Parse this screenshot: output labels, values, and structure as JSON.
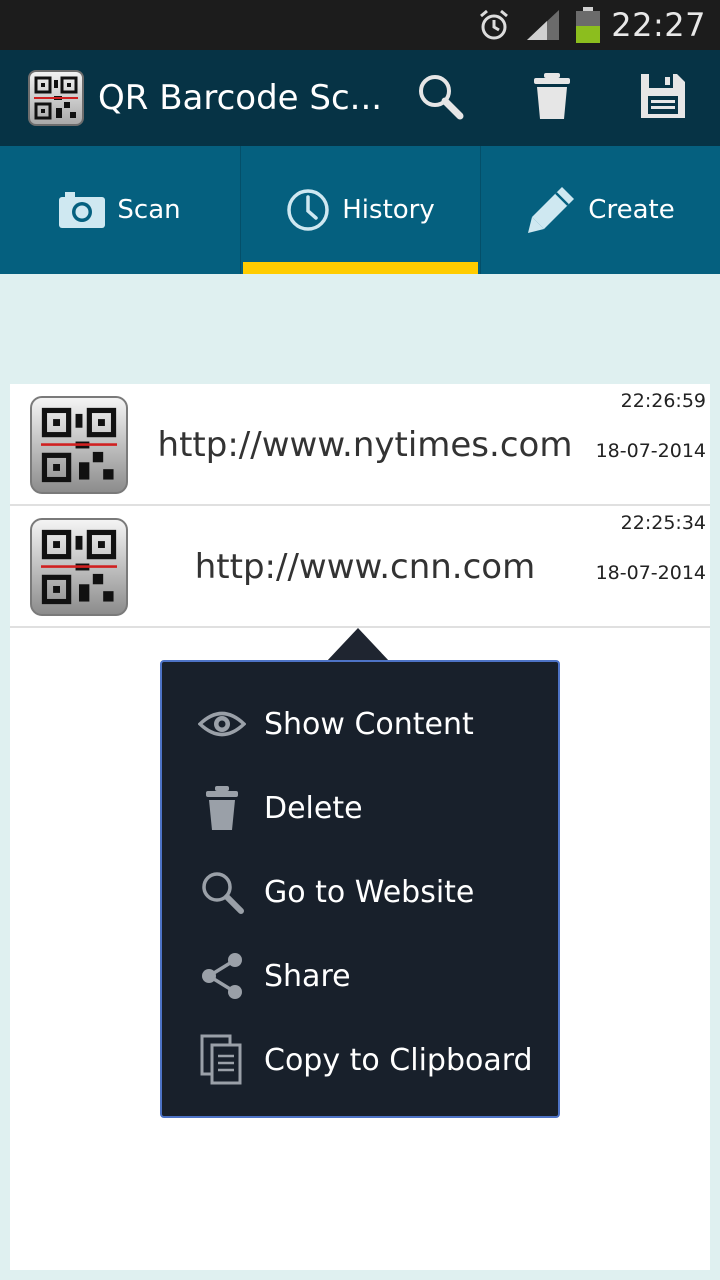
{
  "status_bar": {
    "time": "22:27",
    "icons": [
      "alarm-icon",
      "signal-icon",
      "battery-icon"
    ]
  },
  "action_bar": {
    "title": "QR Barcode Sc...",
    "actions": [
      "search-icon",
      "trash-icon",
      "save-icon"
    ]
  },
  "tabs": [
    {
      "label": "Scan",
      "icon": "camera-icon",
      "active": false
    },
    {
      "label": "History",
      "icon": "clock-icon",
      "active": true
    },
    {
      "label": "Create",
      "icon": "pencil-icon",
      "active": false
    }
  ],
  "history": [
    {
      "url": "http://www.nytimes.com",
      "time": "22:26:59",
      "date": "18-07-2014"
    },
    {
      "url": "http://www.cnn.com",
      "time": "22:25:34",
      "date": "18-07-2014"
    }
  ],
  "context_menu": {
    "items": [
      {
        "label": "Show Content",
        "icon": "eye-icon"
      },
      {
        "label": "Delete",
        "icon": "trash-icon"
      },
      {
        "label": "Go to Website",
        "icon": "search-icon"
      },
      {
        "label": "Share",
        "icon": "share-icon"
      },
      {
        "label": "Copy to Clipboard",
        "icon": "clipboard-icon"
      }
    ]
  },
  "colors": {
    "action_bar": "#063345",
    "tab_bar": "#05607f",
    "tab_indicator": "#ffcc00",
    "background": "#dff0f0",
    "popup": "#18202b",
    "popup_border": "#4d73c6"
  }
}
